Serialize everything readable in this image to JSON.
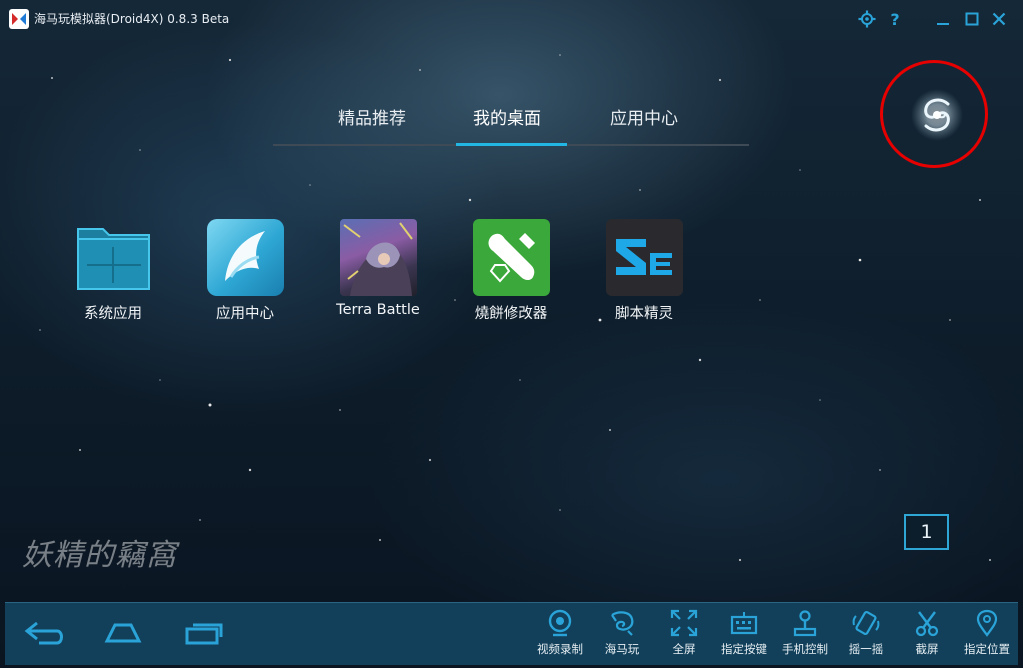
{
  "window": {
    "title": "海马玩模拟器(Droid4X) 0.8.3 Beta"
  },
  "tabs": [
    {
      "label": "精品推荐",
      "active": false
    },
    {
      "label": "我的桌面",
      "active": true
    },
    {
      "label": "应用中心",
      "active": false
    }
  ],
  "desktop": {
    "apps": [
      {
        "label": "系统应用",
        "icon": "folder-icon"
      },
      {
        "label": "应用中心",
        "icon": "app-center-icon"
      },
      {
        "label": "Terra Battle",
        "icon": "terra-battle-icon"
      },
      {
        "label": "燒餅修改器",
        "icon": "wrench-icon"
      },
      {
        "label": "脚本精灵",
        "icon": "script-se-icon"
      }
    ],
    "page_number": "1"
  },
  "watermark": "妖精的竊窩",
  "bottom_toolbar": [
    {
      "label": "视频录制",
      "icon": "webcam-icon"
    },
    {
      "label": "海马玩",
      "icon": "seahorse-icon"
    },
    {
      "label": "全屏",
      "icon": "fullscreen-icon"
    },
    {
      "label": "指定按键",
      "icon": "keyboard-icon"
    },
    {
      "label": "手机控制",
      "icon": "joystick-icon"
    },
    {
      "label": "摇一摇",
      "icon": "shake-icon"
    },
    {
      "label": "截屏",
      "icon": "scissors-icon"
    },
    {
      "label": "指定位置",
      "icon": "location-pin-icon"
    }
  ],
  "colors": {
    "accent": "#22b6e4",
    "highlight_circle": "#e60000",
    "bottom_bar": "#12405a"
  }
}
